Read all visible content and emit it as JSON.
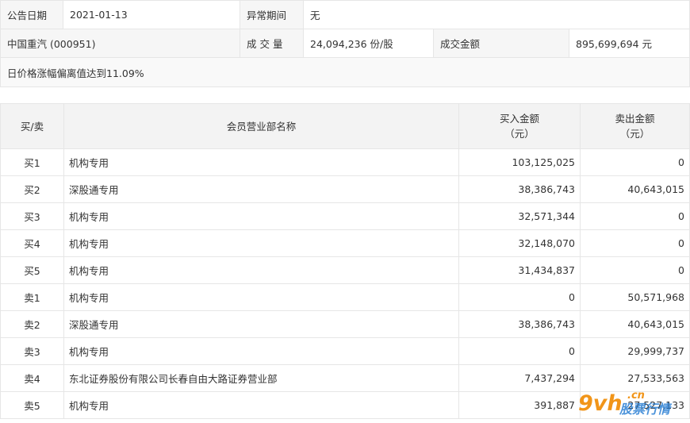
{
  "info": {
    "announce_date_label": "公告日期",
    "announce_date_value": "2021-01-13",
    "abnormal_period_label": "异常期间",
    "abnormal_period_value": "无",
    "stock_name": "中国重汽 (000951)",
    "volume_label": "成 交 量",
    "volume_value": "24,094,236 份/股",
    "amount_label": "成交金额",
    "amount_value": "895,699,694 元",
    "reason": "日价格涨幅偏离值达到11.09%"
  },
  "table": {
    "headers": {
      "side": "买/卖",
      "branch": "会员营业部名称",
      "buy_line1": "买入金额",
      "buy_line2": "（元）",
      "sell_line1": "卖出金额",
      "sell_line2": "（元）"
    },
    "rows": [
      {
        "side": "买1",
        "branch": "机构专用",
        "buy": "103,125,025",
        "sell": "0"
      },
      {
        "side": "买2",
        "branch": "深股通专用",
        "buy": "38,386,743",
        "sell": "40,643,015"
      },
      {
        "side": "买3",
        "branch": "机构专用",
        "buy": "32,571,344",
        "sell": "0"
      },
      {
        "side": "买4",
        "branch": "机构专用",
        "buy": "32,148,070",
        "sell": "0"
      },
      {
        "side": "买5",
        "branch": "机构专用",
        "buy": "31,434,837",
        "sell": "0"
      },
      {
        "side": "卖1",
        "branch": "机构专用",
        "buy": "0",
        "sell": "50,571,968"
      },
      {
        "side": "卖2",
        "branch": "深股通专用",
        "buy": "38,386,743",
        "sell": "40,643,015"
      },
      {
        "side": "卖3",
        "branch": "机构专用",
        "buy": "0",
        "sell": "29,999,737"
      },
      {
        "side": "卖4",
        "branch": "东北证券股份有限公司长春自由大路证券营业部",
        "buy": "7,437,294",
        "sell": "27,533,563"
      },
      {
        "side": "卖5",
        "branch": "机构专用",
        "buy": "391,887",
        "sell": "27,527,133"
      }
    ]
  },
  "watermark": {
    "logo_text": "9vh",
    "domain_text": ".cn",
    "tagline": "股票行情",
    "colors": {
      "logo": "#f08a00",
      "tagline": "#2a7fd4"
    }
  }
}
